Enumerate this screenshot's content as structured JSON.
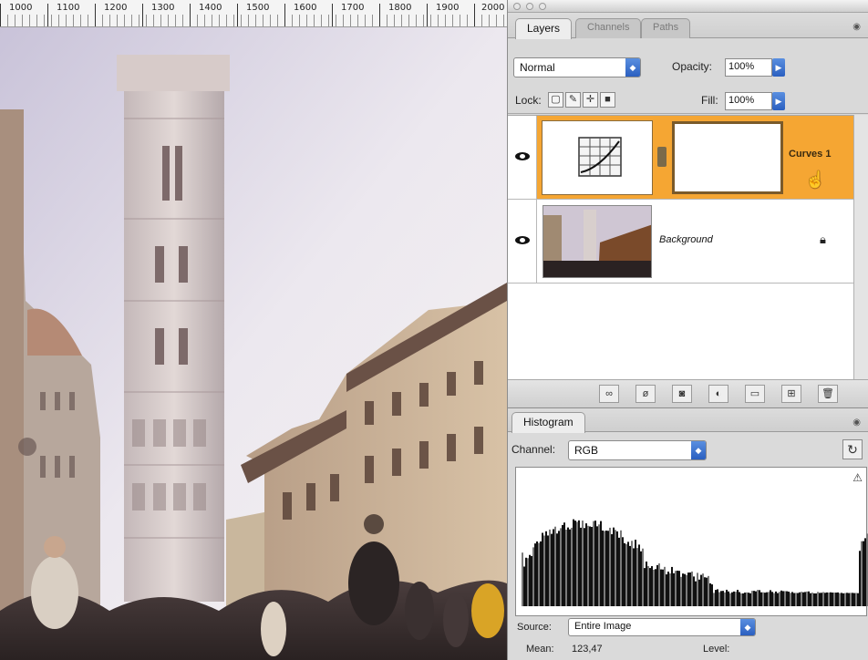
{
  "ruler": {
    "labels": [
      "1000",
      "1100",
      "1200",
      "1300",
      "1400",
      "1500",
      "1600",
      "1700",
      "1800",
      "1900",
      "2000"
    ]
  },
  "layers_panel": {
    "tabs": [
      {
        "label": "Layers",
        "active": true
      },
      {
        "label": "Channels",
        "active": false
      },
      {
        "label": "Paths",
        "active": false
      }
    ],
    "blend_mode": "Normal",
    "opacity_label": "Opacity:",
    "opacity_value": "100%",
    "lock_label": "Lock:",
    "fill_label": "Fill:",
    "fill_value": "100%",
    "layers": [
      {
        "name": "Curves 1",
        "selected": true,
        "highlight_color": "#f5a633"
      },
      {
        "name": "Background",
        "selected": false
      }
    ]
  },
  "histogram_panel": {
    "tab": "Histogram",
    "channel_label": "Channel:",
    "channel_value": "RGB",
    "source_label": "Source:",
    "source_value": "Entire Image",
    "mean_label": "Mean:",
    "mean_value": "123,47",
    "level_label": "Level:"
  },
  "colors": {
    "selection": "#f5a633",
    "accent_blue": "#2a5fc0"
  }
}
